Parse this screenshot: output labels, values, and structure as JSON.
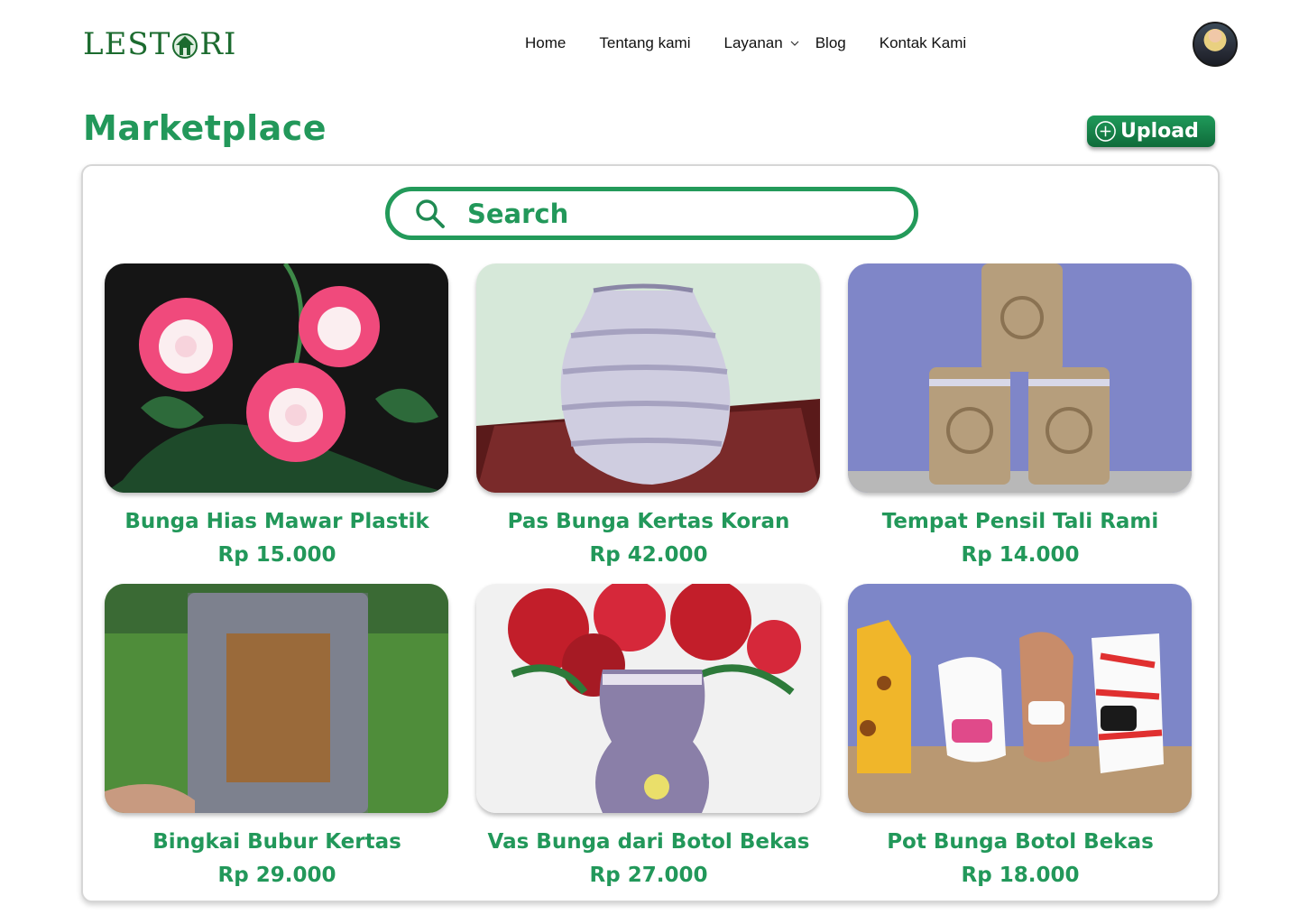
{
  "brand": {
    "logo_text_left": "LEST",
    "logo_text_right": "RI"
  },
  "nav": {
    "items": [
      {
        "label": "Home"
      },
      {
        "label": "Tentang kami"
      },
      {
        "label": "Layanan"
      },
      {
        "label": "Blog"
      },
      {
        "label": "Kontak Kami"
      }
    ]
  },
  "page": {
    "title": "Marketplace",
    "upload_label": "Upload"
  },
  "search": {
    "placeholder": "Search"
  },
  "products": [
    {
      "name": "Bunga Hias Mawar Plastik",
      "price": "Rp 15.000"
    },
    {
      "name": "Pas Bunga Kertas Koran",
      "price": "Rp 42.000"
    },
    {
      "name": "Tempat Pensil Tali Rami",
      "price": "Rp 14.000"
    },
    {
      "name": "Bingkai Bubur Kertas",
      "price": "Rp 29.000"
    },
    {
      "name": "Vas Bunga dari Botol Bekas",
      "price": "Rp 27.000"
    },
    {
      "name": "Pot Bunga Botol Bekas",
      "price": "Rp 18.000"
    }
  ],
  "colors": {
    "accent": "#22985a",
    "button_dark": "#0f6b3a",
    "logo": "#1c6b2f"
  },
  "icons": [
    "logo-house-icon",
    "chevron-down-icon",
    "plus-circle-icon",
    "search-icon"
  ]
}
